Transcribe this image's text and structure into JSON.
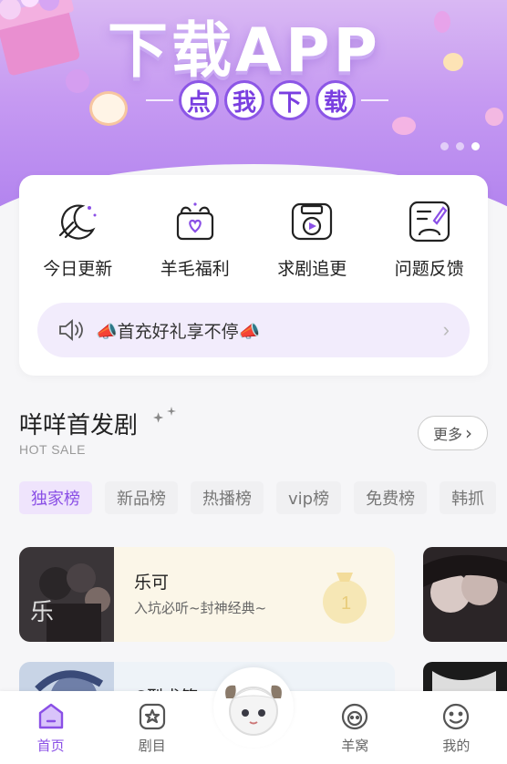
{
  "banner": {
    "title": "下载APP",
    "subtitle_chars": [
      "点",
      "我",
      "下",
      "载"
    ],
    "carousel_dots": 3,
    "active_dot": 2
  },
  "functions": [
    {
      "label": "今日更新",
      "icon": "moon-update-icon"
    },
    {
      "label": "羊毛福利",
      "icon": "gift-box-icon"
    },
    {
      "label": "求剧追更",
      "icon": "radio-fm-icon"
    },
    {
      "label": "问题反馈",
      "icon": "feedback-edit-icon"
    }
  ],
  "notice": {
    "text": "📣首充好礼享不停📣",
    "icon": "speaker-icon"
  },
  "section": {
    "title": "咩咩首发剧",
    "subtitle": "HOT SALE",
    "more_label": "更多"
  },
  "tabs": [
    "独家榜",
    "新品榜",
    "热播榜",
    "vip榜",
    "免费榜",
    "韩抓"
  ],
  "active_tab": 0,
  "items": [
    {
      "name": "乐可",
      "desc": "入坑必听~封神经典~"
    },
    {
      "name": "C型求签",
      "desc": ""
    }
  ],
  "nav": [
    {
      "label": "首页",
      "icon": "home-icon"
    },
    {
      "label": "剧目",
      "icon": "star-icon"
    },
    {
      "label": "",
      "icon": "sheep-avatar-icon"
    },
    {
      "label": "羊窝",
      "icon": "sheep-face-icon"
    },
    {
      "label": "我的",
      "icon": "smile-icon"
    }
  ],
  "active_nav": 0,
  "colors": {
    "accent": "#8a4fe6",
    "banner": "#c69af2",
    "notice_bg": "#f2ecfc"
  }
}
